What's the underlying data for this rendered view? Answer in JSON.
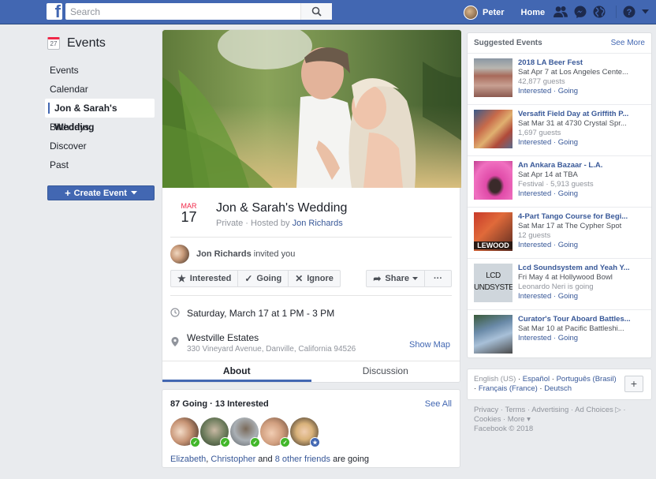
{
  "topbar": {
    "logo": "f",
    "search_placeholder": "Search",
    "user_name": "Peter",
    "home_label": "Home",
    "icons": [
      "friends-icon",
      "messenger-icon",
      "notifications-globe-icon",
      "help-icon",
      "account-dropdown-icon"
    ]
  },
  "sidebar": {
    "title": "Events",
    "calendar_day": "27",
    "items": [
      {
        "label": "Events",
        "active": false
      },
      {
        "label": "Calendar",
        "active": false
      },
      {
        "label": "Jon & Sarah's Wedding",
        "active": true
      },
      {
        "label": "Birthdays",
        "active": false
      },
      {
        "label": "Discover",
        "active": false
      },
      {
        "label": "Past",
        "active": false
      }
    ],
    "create_label": "Create Event"
  },
  "event": {
    "month": "MAR",
    "day": "17",
    "title": "Jon & Sarah's Wedding",
    "privacy": "Private · Hosted by ",
    "host": "Jon Richards",
    "inviter": "Jon Richards",
    "invite_text": " invited you",
    "actions": {
      "interested": "Interested",
      "going": "Going",
      "ignore": "Ignore",
      "share": "Share",
      "more": "···"
    },
    "datetime": "Saturday, March 17 at 1 PM - 3 PM",
    "location_name": "Westville Estates",
    "location_address": "330 Vineyard Avenue, Danville, California 94526",
    "show_map": "Show Map",
    "tabs": [
      {
        "label": "About",
        "active": true
      },
      {
        "label": "Discussion",
        "active": false
      }
    ]
  },
  "guests": {
    "summary": "87 Going · 13 Interested",
    "see_all": "See All",
    "friend1": "Elizabeth",
    "sep1": ", ",
    "friend2": "Christopher",
    "and": " and ",
    "others": "8 other friends",
    "tail": " are going",
    "faces": [
      {
        "status": "going"
      },
      {
        "status": "going"
      },
      {
        "status": "going"
      },
      {
        "status": "going"
      },
      {
        "status": "interested"
      }
    ]
  },
  "suggested": {
    "title": "Suggested Events",
    "see_more": "See More",
    "items": [
      {
        "title": "2018 LA Beer Fest",
        "date": "Sat Apr 7 at Los Angeles Cente...",
        "meta": "42,877 guests",
        "interested": "Interested",
        "going": "Going"
      },
      {
        "title": "Versafit Field Day at Griffith P...",
        "date": "Sat Mar 31 at 4730 Crystal Spr...",
        "meta": "1,697 guests",
        "interested": "Interested",
        "going": "Going"
      },
      {
        "title": "An Ankara Bazaar - L.A.",
        "date": "Sat Apr 14 at TBA",
        "meta": "Festival · 5,913 guests",
        "interested": "Interested",
        "going": "Going"
      },
      {
        "title": "4-Part Tango Course for Begi...",
        "date": "Sat Mar 17 at The Cypher Spot",
        "meta": "12 guests",
        "interested": "Interested",
        "going": "Going",
        "thumb_text": "LEWOOD"
      },
      {
        "title": "Lcd Soundsystem and Yeah Y...",
        "date": "Fri May 4 at Hollywood Bowl",
        "meta": "Leonardo Neri is going",
        "interested": "Interested",
        "going": "Going",
        "thumb_text": "LCD\nUNDSYSTE"
      },
      {
        "title": "Curator's Tour Aboard Battles...",
        "date": "Sat Mar 10 at Pacific Battleshi...",
        "meta": "",
        "interested": "Interested",
        "going": "Going"
      }
    ]
  },
  "languages": {
    "current": "English (US)",
    "others": [
      "Español",
      "Português (Brasil)",
      "Français (France)",
      "Deutsch"
    ],
    "plus": "+"
  },
  "footer": {
    "links": [
      "Privacy",
      "Terms",
      "Advertising",
      "Ad Choices",
      "Cookies",
      "More"
    ],
    "copyright": "Facebook © 2018"
  }
}
